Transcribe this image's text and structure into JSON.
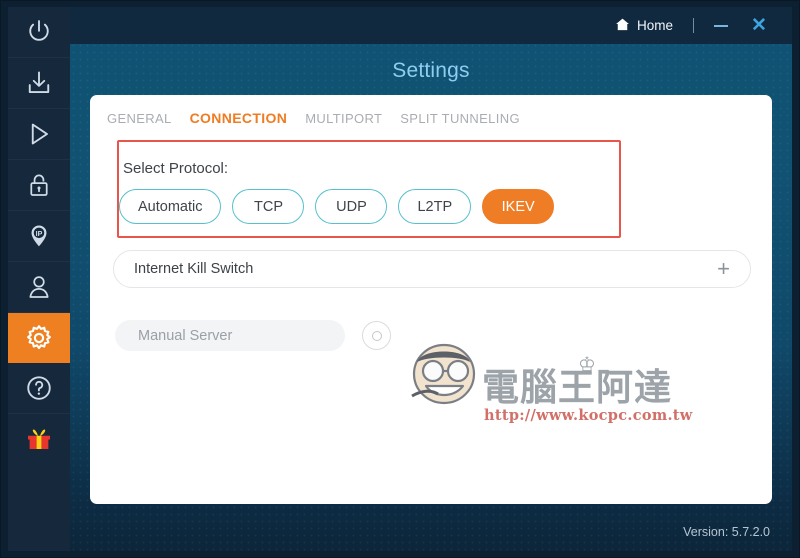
{
  "window": {
    "title": "Settings",
    "home_label": "Home",
    "minimize_label": "—",
    "close_label": "✕",
    "version_label": "Version: 5.7.2.0"
  },
  "sidebar": {
    "items": [
      {
        "name": "power",
        "icon": "power-icon",
        "active": false
      },
      {
        "name": "download",
        "icon": "download-icon",
        "active": false
      },
      {
        "name": "play",
        "icon": "play-icon",
        "active": false
      },
      {
        "name": "lock",
        "icon": "lock-icon",
        "active": false
      },
      {
        "name": "ip",
        "icon": "ip-pin-icon",
        "active": false
      },
      {
        "name": "account",
        "icon": "user-icon",
        "active": false
      },
      {
        "name": "settings",
        "icon": "gear-icon",
        "active": true
      },
      {
        "name": "help",
        "icon": "question-icon",
        "active": false
      },
      {
        "name": "gift",
        "icon": "gift-icon",
        "active": false
      }
    ]
  },
  "tabs": [
    {
      "label": "GENERAL",
      "active": false
    },
    {
      "label": "CONNECTION",
      "active": true
    },
    {
      "label": "MULTIPORT",
      "active": false
    },
    {
      "label": "SPLIT TUNNELING",
      "active": false
    }
  ],
  "protocol": {
    "label": "Select Protocol:",
    "options": [
      {
        "label": "Automatic",
        "selected": false
      },
      {
        "label": "TCP",
        "selected": false
      },
      {
        "label": "UDP",
        "selected": false
      },
      {
        "label": "L2TP",
        "selected": false
      },
      {
        "label": "IKEV",
        "selected": true
      }
    ]
  },
  "kill_switch": {
    "label": "Internet Kill Switch",
    "expand_icon": "+"
  },
  "manual_server": {
    "label": "Manual Server",
    "toggle_state": "off"
  },
  "watermark": {
    "text": "電腦王阿達",
    "crown": "♔",
    "url": "http://www.kocpc.com.tw"
  },
  "colors": {
    "accent_orange": "#ee7d26",
    "pill_border_teal": "#57c0ce",
    "annotation_red": "#e8554a",
    "title_blue": "#8ecdf0",
    "sidebar_dark": "#16283c",
    "stage_teal": "#115272"
  }
}
